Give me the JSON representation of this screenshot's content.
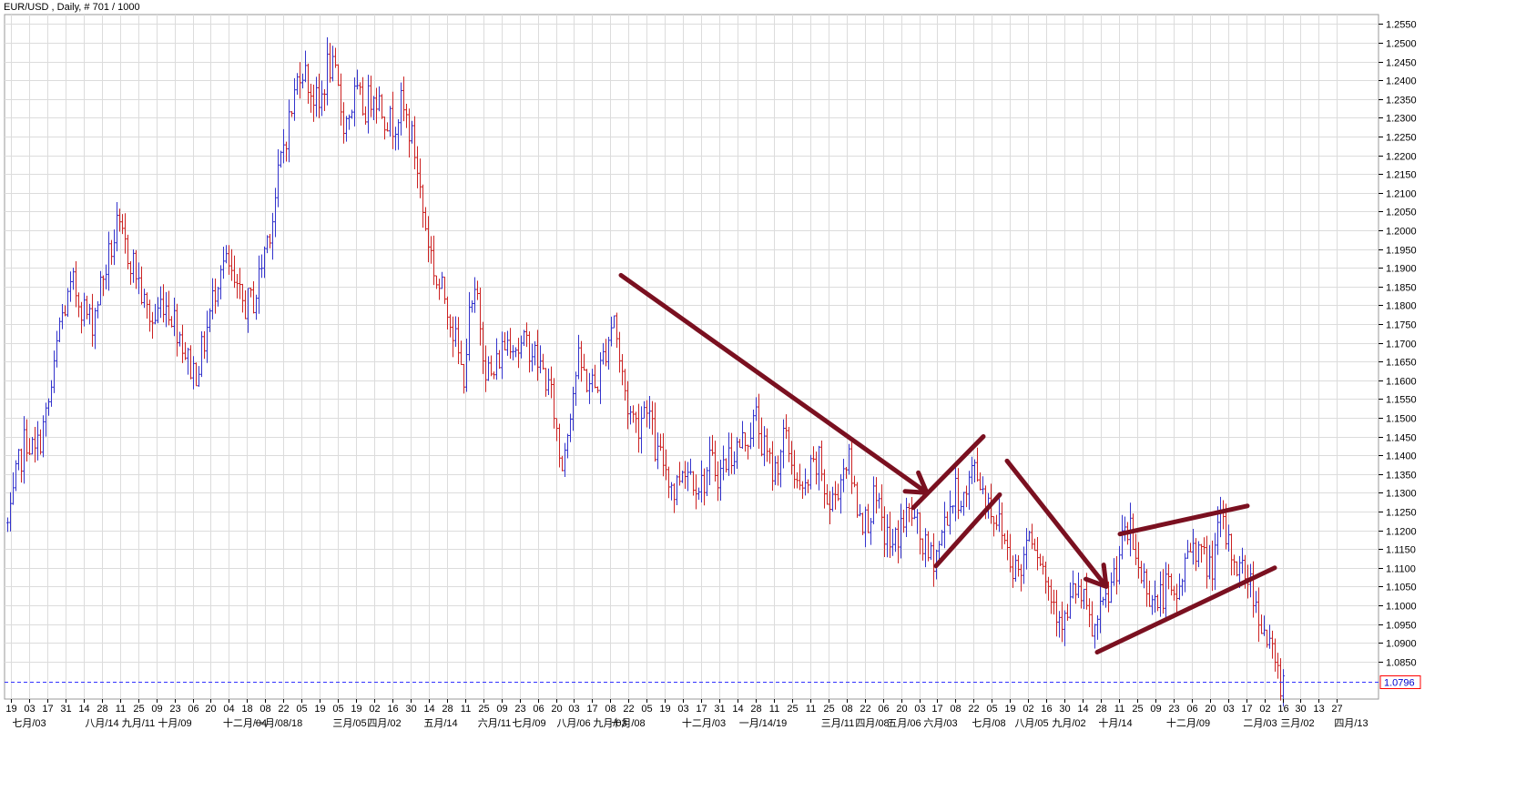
{
  "header": {
    "title": "EUR/USD , Daily, # 701 / 1000"
  },
  "colors": {
    "grid": "#dcdcdc",
    "up": "#3333cc",
    "down": "#cc2222",
    "neutral": "#000000",
    "annotation": "#7a1020",
    "price_line": "#3333ff",
    "price_box": "#ff0000"
  },
  "chart_data": {
    "type": "ohlc",
    "symbol": "EUR/USD",
    "timeframe": "Daily",
    "title": "EUR/USD , Daily, # 701 / 1000",
    "ylim": [
      1.075,
      1.2575
    ],
    "grid": true,
    "y_ticks": [
      "1.2550",
      "1.2500",
      "1.2450",
      "1.2400",
      "1.2350",
      "1.2300",
      "1.2250",
      "1.2200",
      "1.2150",
      "1.2100",
      "1.2050",
      "1.2000",
      "1.1950",
      "1.1900",
      "1.1850",
      "1.1800",
      "1.1750",
      "1.1700",
      "1.1650",
      "1.1600",
      "1.1550",
      "1.1500",
      "1.1450",
      "1.1400",
      "1.1350",
      "1.1300",
      "1.1250",
      "1.1200",
      "1.1150",
      "1.1100",
      "1.1050",
      "1.1000",
      "1.0950",
      "1.0900",
      "1.0850"
    ],
    "current_price": "1.0796",
    "x_day_labels": [
      "19",
      "03",
      "17",
      "31",
      "14",
      "28",
      "11",
      "25",
      "09",
      "23",
      "06",
      "20",
      "04",
      "18",
      "08",
      "22",
      "05",
      "19",
      "05",
      "19",
      "02",
      "16",
      "30",
      "14",
      "28",
      "11",
      "25",
      "09",
      "23",
      "06",
      "20",
      "03",
      "17",
      "08",
      "22",
      "05",
      "19",
      "03",
      "17",
      "31",
      "14",
      "28",
      "11",
      "25",
      "11",
      "25",
      "08",
      "22",
      "06",
      "20",
      "03",
      "17",
      "08",
      "22",
      "05",
      "19",
      "02",
      "16",
      "30",
      "14",
      "28",
      "11",
      "25",
      "09",
      "23",
      "06",
      "20",
      "03",
      "17",
      "02",
      "16",
      "30",
      "13",
      "27"
    ],
    "x_month_labels": [
      "七月/03",
      "八月/14",
      "九月/11",
      "十月/09",
      "十二月/04",
      "一月/08/18",
      "三月/05",
      "四月/02",
      "五月/14",
      "六月/11",
      "七月/09",
      "八月/06",
      "九月/03",
      "十月/08",
      "十二月/03",
      "一月/14/19",
      "三月/11",
      "四月/08",
      "五月/06",
      "六月/03",
      "七月/08",
      "八月/05",
      "九月/02",
      "十月/14",
      "十二月/09",
      "二月/03",
      "三月/02",
      "四月/13"
    ],
    "price_path": [
      [
        0,
        1.122
      ],
      [
        10,
        1.121
      ],
      [
        18,
        1.135
      ],
      [
        28,
        1.145
      ],
      [
        38,
        1.14
      ],
      [
        50,
        1.15
      ],
      [
        58,
        1.16
      ],
      [
        65,
        1.175
      ],
      [
        72,
        1.18
      ],
      [
        80,
        1.185
      ],
      [
        90,
        1.18
      ],
      [
        100,
        1.175
      ],
      [
        110,
        1.185
      ],
      [
        118,
        1.192
      ],
      [
        128,
        1.2
      ],
      [
        138,
        1.195
      ],
      [
        148,
        1.19
      ],
      [
        158,
        1.18
      ],
      [
        168,
        1.175
      ],
      [
        178,
        1.182
      ],
      [
        188,
        1.178
      ],
      [
        198,
        1.172
      ],
      [
        206,
        1.165
      ],
      [
        214,
        1.162
      ],
      [
        222,
        1.168
      ],
      [
        232,
        1.18
      ],
      [
        242,
        1.192
      ],
      [
        250,
        1.19
      ],
      [
        260,
        1.182
      ],
      [
        270,
        1.18
      ],
      [
        280,
        1.182
      ],
      [
        290,
        1.195
      ],
      [
        300,
        1.205
      ],
      [
        310,
        1.222
      ],
      [
        320,
        1.232
      ],
      [
        330,
        1.245
      ],
      [
        340,
        1.238
      ],
      [
        350,
        1.232
      ],
      [
        360,
        1.245
      ],
      [
        368,
        1.24
      ],
      [
        378,
        1.228
      ],
      [
        390,
        1.236
      ],
      [
        400,
        1.232
      ],
      [
        410,
        1.238
      ],
      [
        420,
        1.232
      ],
      [
        430,
        1.228
      ],
      [
        440,
        1.233
      ],
      [
        448,
        1.228
      ],
      [
        456,
        1.22
      ],
      [
        464,
        1.205
      ],
      [
        472,
        1.195
      ],
      [
        480,
        1.185
      ],
      [
        490,
        1.182
      ],
      [
        500,
        1.17
      ],
      [
        508,
        1.16
      ],
      [
        516,
        1.178
      ],
      [
        524,
        1.182
      ],
      [
        532,
        1.165
      ],
      [
        540,
        1.16
      ],
      [
        550,
        1.168
      ],
      [
        560,
        1.172
      ],
      [
        570,
        1.168
      ],
      [
        580,
        1.17
      ],
      [
        590,
        1.165
      ],
      [
        600,
        1.16
      ],
      [
        608,
        1.152
      ],
      [
        616,
        1.136
      ],
      [
        624,
        1.15
      ],
      [
        634,
        1.165
      ],
      [
        644,
        1.16
      ],
      [
        654,
        1.158
      ],
      [
        664,
        1.168
      ],
      [
        674,
        1.178
      ],
      [
        680,
        1.165
      ],
      [
        690,
        1.152
      ],
      [
        700,
        1.148
      ],
      [
        710,
        1.155
      ],
      [
        720,
        1.14
      ],
      [
        730,
        1.138
      ],
      [
        740,
        1.13
      ],
      [
        750,
        1.138
      ],
      [
        760,
        1.135
      ],
      [
        770,
        1.132
      ],
      [
        780,
        1.138
      ],
      [
        790,
        1.135
      ],
      [
        800,
        1.14
      ],
      [
        810,
        1.142
      ],
      [
        820,
        1.145
      ],
      [
        830,
        1.15
      ],
      [
        840,
        1.14
      ],
      [
        850,
        1.135
      ],
      [
        860,
        1.145
      ],
      [
        870,
        1.138
      ],
      [
        880,
        1.128
      ],
      [
        890,
        1.135
      ],
      [
        900,
        1.138
      ],
      [
        910,
        1.125
      ],
      [
        920,
        1.132
      ],
      [
        930,
        1.14
      ],
      [
        940,
        1.128
      ],
      [
        950,
        1.122
      ],
      [
        960,
        1.128
      ],
      [
        970,
        1.12
      ],
      [
        980,
        1.115
      ],
      [
        990,
        1.122
      ],
      [
        1000,
        1.125
      ],
      [
        1010,
        1.118
      ],
      [
        1020,
        1.112
      ],
      [
        1030,
        1.115
      ],
      [
        1040,
        1.125
      ],
      [
        1050,
        1.13
      ],
      [
        1060,
        1.128
      ],
      [
        1070,
        1.138
      ],
      [
        1080,
        1.13
      ],
      [
        1090,
        1.125
      ],
      [
        1100,
        1.12
      ],
      [
        1110,
        1.112
      ],
      [
        1120,
        1.108
      ],
      [
        1130,
        1.122
      ],
      [
        1140,
        1.115
      ],
      [
        1150,
        1.105
      ],
      [
        1160,
        1.1
      ],
      [
        1170,
        1.095
      ],
      [
        1180,
        1.105
      ],
      [
        1190,
        1.1
      ],
      [
        1200,
        1.092
      ],
      [
        1210,
        1.098
      ],
      [
        1220,
        1.105
      ],
      [
        1230,
        1.115
      ],
      [
        1240,
        1.12
      ],
      [
        1250,
        1.11
      ],
      [
        1260,
        1.105
      ],
      [
        1270,
        1.1
      ],
      [
        1280,
        1.105
      ],
      [
        1290,
        1.1
      ],
      [
        1300,
        1.11
      ],
      [
        1310,
        1.118
      ],
      [
        1320,
        1.112
      ],
      [
        1330,
        1.11
      ],
      [
        1340,
        1.122
      ],
      [
        1350,
        1.115
      ],
      [
        1360,
        1.11
      ],
      [
        1370,
        1.108
      ],
      [
        1380,
        1.1
      ],
      [
        1390,
        1.092
      ],
      [
        1398,
        1.085
      ],
      [
        1406,
        1.08
      ]
    ],
    "annotations": [
      {
        "type": "arrow",
        "x1": 682,
        "y1": 1.188,
        "x2": 1018,
        "y2": 1.13
      },
      {
        "type": "line",
        "x1": 1003,
        "y1": 1.126,
        "x2": 1080,
        "y2": 1.145
      },
      {
        "type": "line",
        "x1": 1028,
        "y1": 1.1105,
        "x2": 1098,
        "y2": 1.1295
      },
      {
        "type": "arrow",
        "x1": 1106,
        "y1": 1.1385,
        "x2": 1215,
        "y2": 1.105
      },
      {
        "type": "line",
        "x1": 1230,
        "y1": 1.119,
        "x2": 1370,
        "y2": 1.1265
      },
      {
        "type": "line",
        "x1": 1205,
        "y1": 1.0875,
        "x2": 1400,
        "y2": 1.11
      }
    ]
  }
}
